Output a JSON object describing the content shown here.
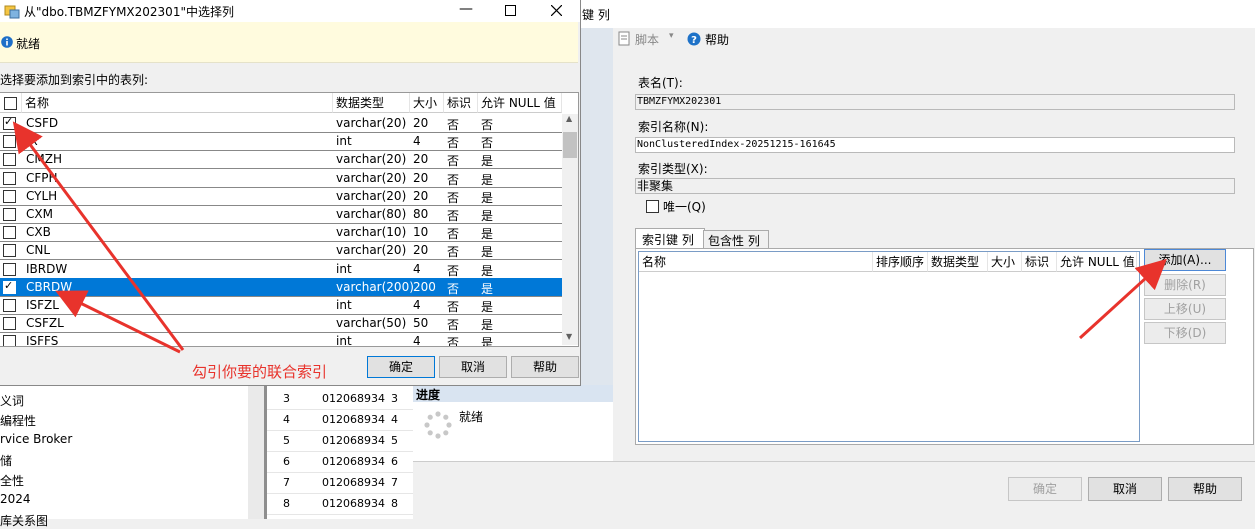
{
  "main": {
    "tab_title": "键 列",
    "toolbar": {
      "script_label": "脚本",
      "help_label": "帮助"
    },
    "table_name_label": "表名(T):",
    "table_name_value": "TBMZFYMX202301",
    "index_name_label": "索引名称(N):",
    "index_name_value": "NonClusteredIndex-20251215-161645",
    "index_type_label": "索引类型(X):",
    "index_type_value": "非聚集",
    "unique_label": "唯一(Q)",
    "tabs": [
      {
        "label": "索引键 列"
      },
      {
        "label": "包含性 列"
      }
    ],
    "columns": [
      "名称",
      "排序顺序",
      "数据类型",
      "大小",
      "标识",
      "允许 NULL 值"
    ],
    "buttons": {
      "add": "添加(A)...",
      "remove": "删除(R)",
      "move_up": "上移(U)",
      "move_down": "下移(D)"
    },
    "bottom": {
      "ok": "确定",
      "cancel": "取消",
      "help": "帮助"
    }
  },
  "progress": {
    "title": "进度",
    "status": "就绪"
  },
  "background_left": [
    "义词",
    "编程性",
    "rvice Broker",
    "储",
    "全性",
    "2024",
    "库关系图"
  ],
  "background_grid": [
    {
      "a": "3",
      "b": "012068934",
      "c": "3"
    },
    {
      "a": "4",
      "b": "012068934",
      "c": "4"
    },
    {
      "a": "5",
      "b": "012068934",
      "c": "5"
    },
    {
      "a": "6",
      "b": "012068934",
      "c": "6"
    },
    {
      "a": "7",
      "b": "012068934",
      "c": "7"
    },
    {
      "a": "8",
      "b": "012068934",
      "c": "8"
    }
  ],
  "dialog": {
    "title": "从\"dbo.TBMZFYMX202301\"中选择列",
    "status": "就绪",
    "instruction": "选择要添加到索引中的表列:",
    "headers": [
      "名称",
      "数据类型",
      "大小",
      "标识",
      "允许 NULL 值"
    ],
    "rows": [
      {
        "checked": true,
        "name": "CSFD",
        "type": "varchar(20)",
        "size": "20",
        "identity": "否",
        "nullable": "否"
      },
      {
        "checked": false,
        "name": "IX",
        "type": "int",
        "size": "4",
        "identity": "否",
        "nullable": "否"
      },
      {
        "checked": false,
        "name": "CMZH",
        "type": "varchar(20)",
        "size": "20",
        "identity": "否",
        "nullable": "是"
      },
      {
        "checked": false,
        "name": "CFPH",
        "type": "varchar(20)",
        "size": "20",
        "identity": "否",
        "nullable": "是"
      },
      {
        "checked": false,
        "name": "CYLH",
        "type": "varchar(20)",
        "size": "20",
        "identity": "否",
        "nullable": "是"
      },
      {
        "checked": false,
        "name": "CXM",
        "type": "varchar(80)",
        "size": "80",
        "identity": "否",
        "nullable": "是"
      },
      {
        "checked": false,
        "name": "CXB",
        "type": "varchar(10)",
        "size": "10",
        "identity": "否",
        "nullable": "是"
      },
      {
        "checked": false,
        "name": "CNL",
        "type": "varchar(20)",
        "size": "20",
        "identity": "否",
        "nullable": "是"
      },
      {
        "checked": false,
        "name": "IBRDW",
        "type": "int",
        "size": "4",
        "identity": "否",
        "nullable": "是"
      },
      {
        "checked": true,
        "name": "CBRDW",
        "type": "varchar(200)",
        "size": "200",
        "identity": "否",
        "nullable": "是",
        "selected": true
      },
      {
        "checked": false,
        "name": "ISFZL",
        "type": "int",
        "size": "4",
        "identity": "否",
        "nullable": "是"
      },
      {
        "checked": false,
        "name": "CSFZL",
        "type": "varchar(50)",
        "size": "50",
        "identity": "否",
        "nullable": "是"
      },
      {
        "checked": false,
        "name": "ISFFS",
        "type": "int",
        "size": "4",
        "identity": "否",
        "nullable": "是"
      }
    ],
    "buttons": {
      "ok": "确定",
      "cancel": "取消",
      "help": "帮助"
    }
  },
  "annotation": {
    "text": "勾引你要的联合索引",
    "color": "#e8332c"
  },
  "colors": {
    "selection": "#0078d7",
    "status_bg": "#fffbde",
    "accent": "#0078d7"
  }
}
